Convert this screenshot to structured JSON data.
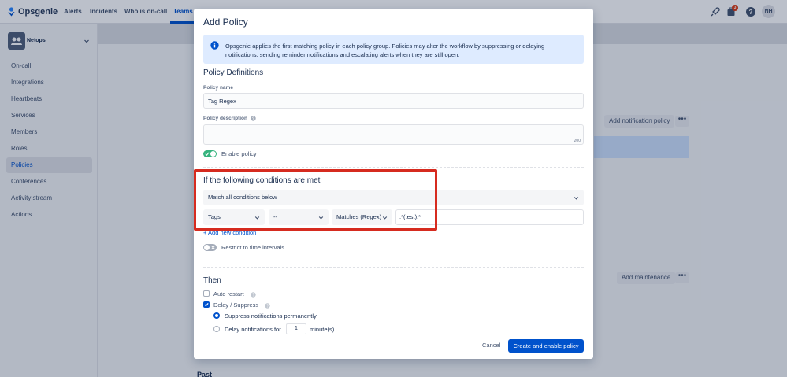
{
  "app": {
    "name": "Opsgenie"
  },
  "topnav": {
    "items": [
      "Alerts",
      "Incidents",
      "Who is on-call",
      "Teams"
    ],
    "active": "Teams",
    "notification_count": "3",
    "user_initials": "NH"
  },
  "sidebar": {
    "team_name": "Netops",
    "items": [
      "On-call",
      "Integrations",
      "Heartbeats",
      "Services",
      "Members",
      "Roles",
      "Policies",
      "Conferences",
      "Activity stream",
      "Actions"
    ],
    "active": "Policies"
  },
  "background": {
    "add_notification_policy": "Add notification policy",
    "add_maintenance": "Add maintenance",
    "more": "•••",
    "past_heading": "Past"
  },
  "modal": {
    "title": "Add Policy",
    "info": "Opsgenie applies the first matching policy in each policy group. Policies may alter the workflow by suppressing or delaying notifications, sending reminder notifications and escalating alerts when they are still open.",
    "definitions_heading": "Policy Definitions",
    "policy_name_label": "Policy name",
    "policy_name_value": "Tag Regex",
    "policy_description_label": "Policy description",
    "description_char_count": "200",
    "enable_policy_label": "Enable policy",
    "enable_policy_on": true,
    "conditions_heading": "If the following conditions are met",
    "match_select_value": "Match all conditions below",
    "condition": {
      "field": "Tags",
      "modifier": "--",
      "operator": "Matches (Regex)",
      "value": ".*(test).*"
    },
    "add_condition_link": "+ Add new condition",
    "restrict_label": "Restrict to time intervals",
    "restrict_on": false,
    "then_heading": "Then",
    "auto_restart_label": "Auto restart",
    "auto_restart_checked": false,
    "delay_suppress_label": "Delay / Suppress",
    "delay_suppress_checked": true,
    "suppress_permanently_label": "Suppress notifications permanently",
    "delay_for_label": "Delay notifications for",
    "delay_value": "1",
    "delay_unit": "minute(s)",
    "cancel_label": "Cancel",
    "submit_label": "Create and enable policy"
  },
  "colors": {
    "primary": "#0052cc",
    "toggle_on": "#36b37e",
    "highlight": "#d62b1f",
    "info_bg": "#deebff"
  }
}
